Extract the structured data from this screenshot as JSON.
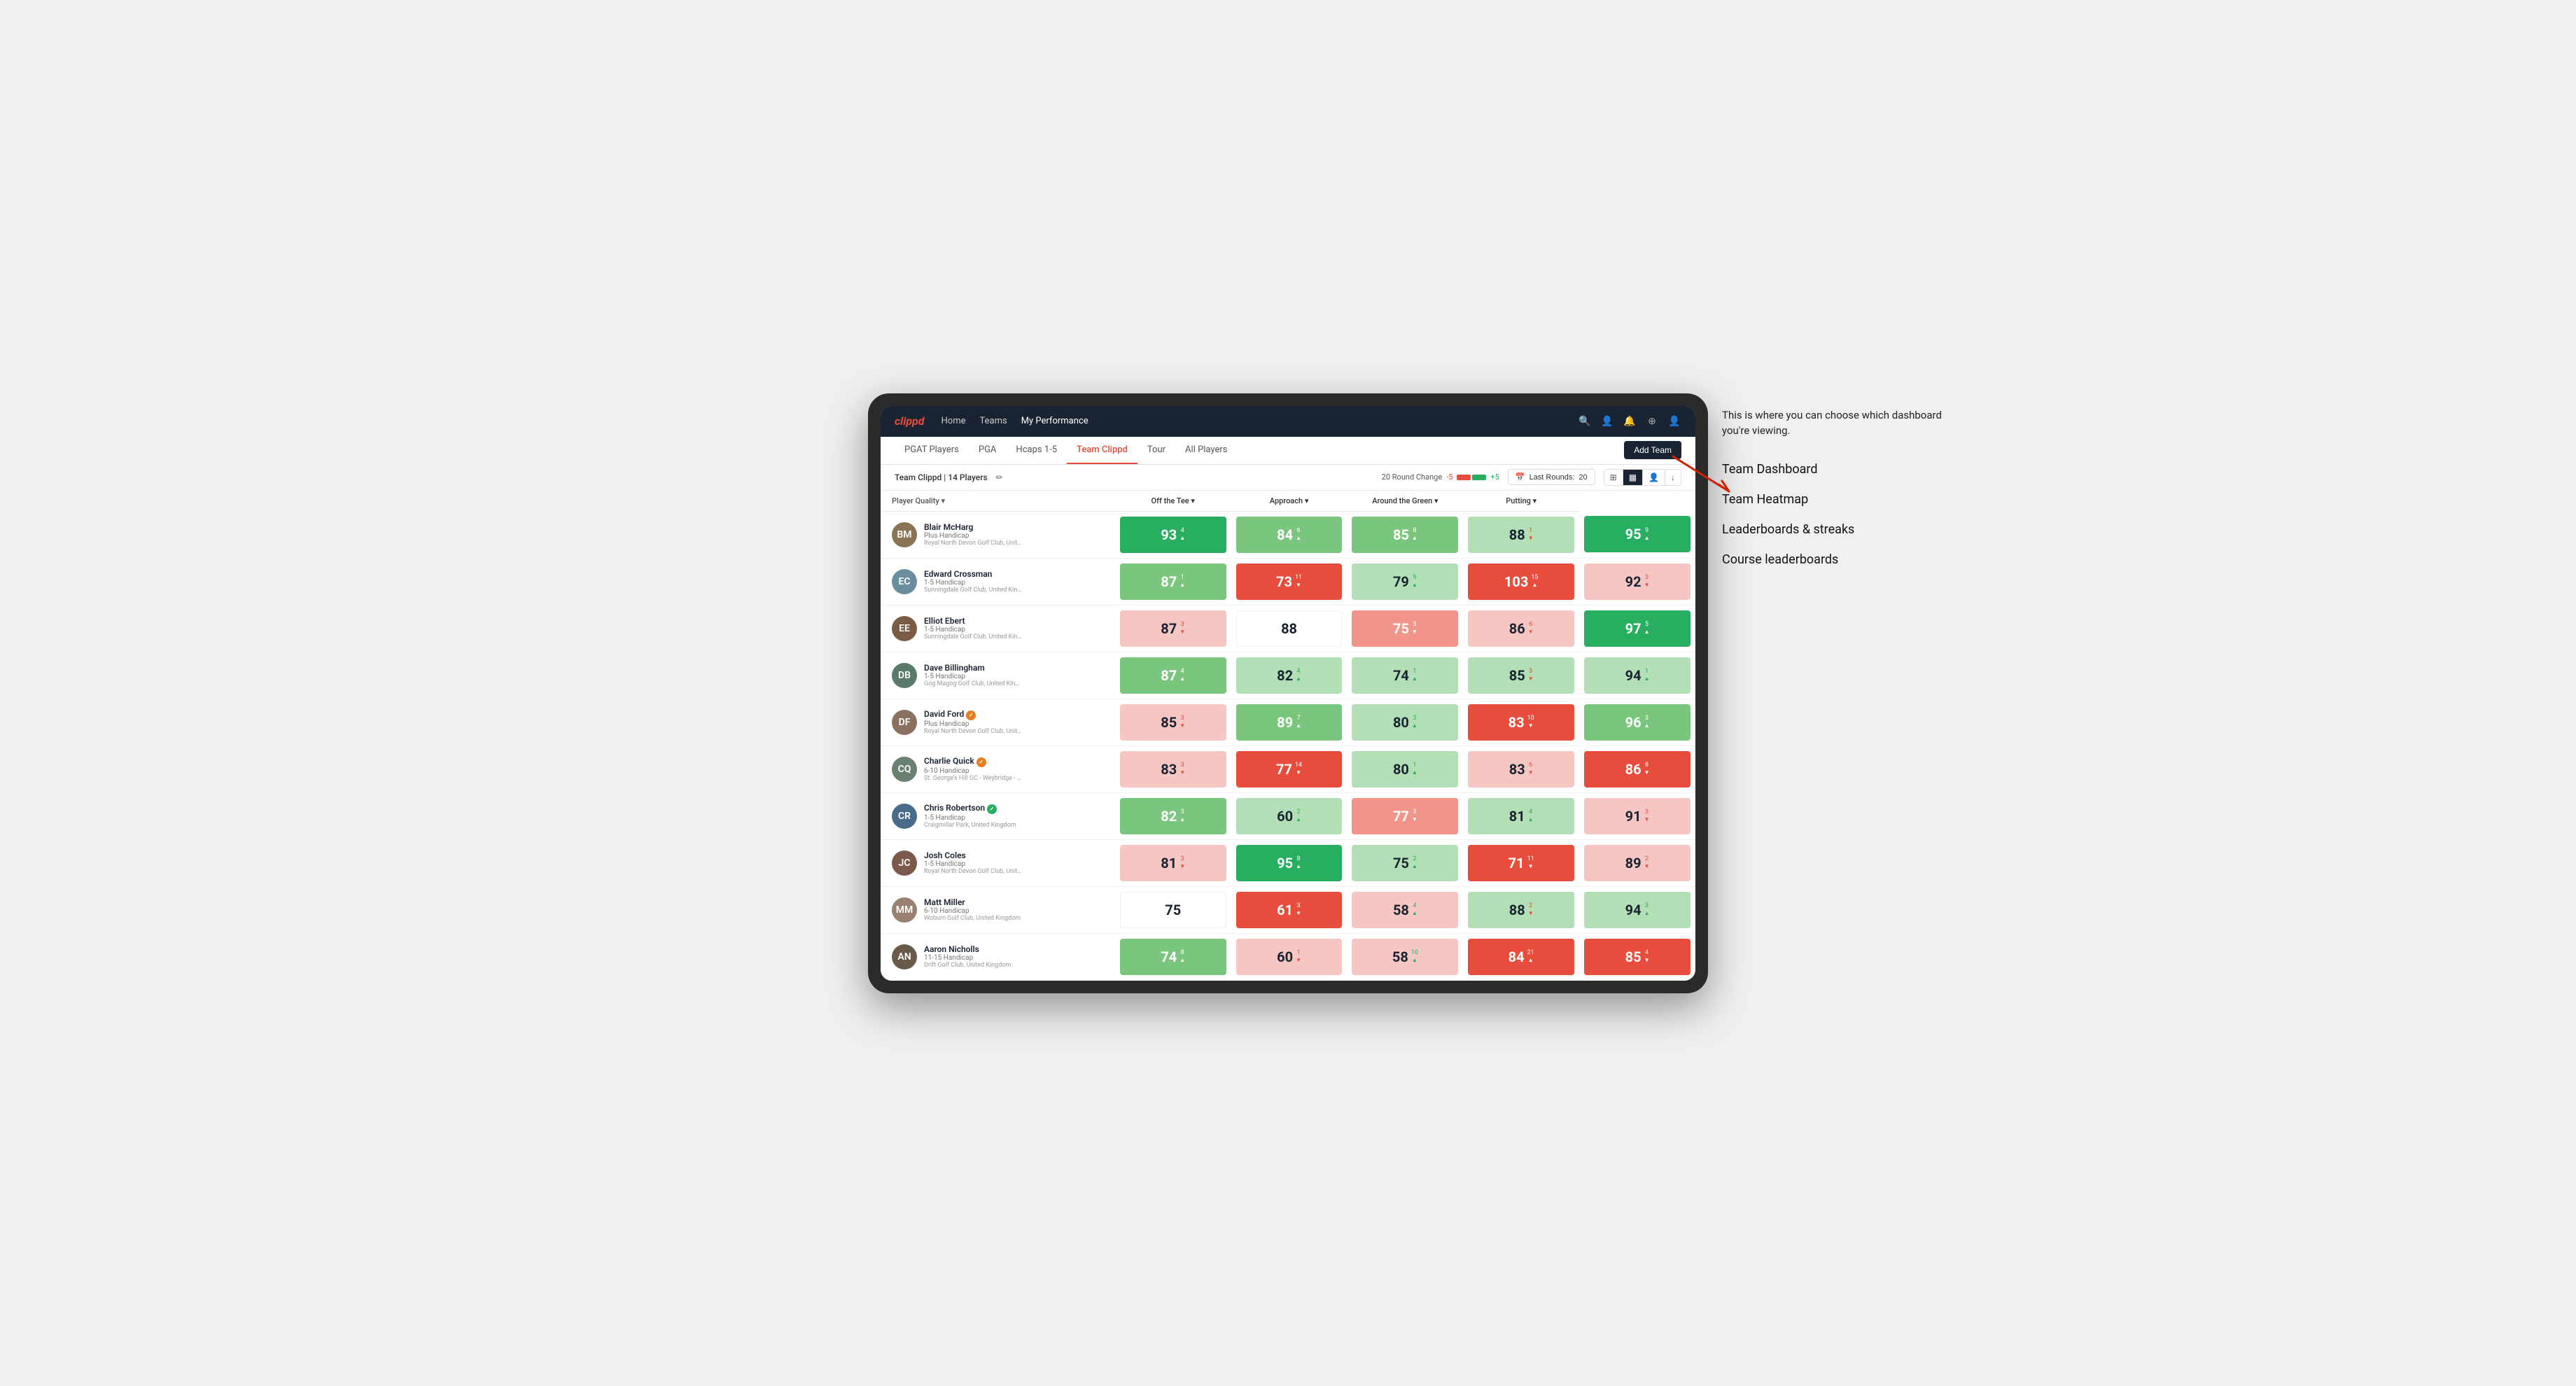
{
  "annotation": {
    "intro": "This is where you can choose which dashboard you're viewing.",
    "menu_items": [
      "Team Dashboard",
      "Team Heatmap",
      "Leaderboards & streaks",
      "Course leaderboards"
    ]
  },
  "nav": {
    "logo": "clippd",
    "links": [
      {
        "label": "Home",
        "active": false
      },
      {
        "label": "Teams",
        "active": false
      },
      {
        "label": "My Performance",
        "active": true
      }
    ],
    "icons": [
      "🔍",
      "👤",
      "🔔",
      "⊕",
      "👤"
    ]
  },
  "subnav": {
    "links": [
      {
        "label": "PGAT Players",
        "active": false
      },
      {
        "label": "PGA",
        "active": false
      },
      {
        "label": "Hcaps 1-5",
        "active": false
      },
      {
        "label": "Team Clippd",
        "active": true
      },
      {
        "label": "Tour",
        "active": false
      },
      {
        "label": "All Players",
        "active": false
      }
    ],
    "add_team_label": "Add Team"
  },
  "toolbar": {
    "team_label": "Team Clippd",
    "player_count": "14 Players",
    "round_change_label": "20 Round Change",
    "round_neg": "-5",
    "round_pos": "+5",
    "last_rounds_label": "Last Rounds:",
    "last_rounds_value": "20",
    "view_options": [
      "grid",
      "heatmap",
      "person",
      "download"
    ]
  },
  "table": {
    "columns": [
      {
        "label": "Player Quality ▾",
        "key": "player_quality"
      },
      {
        "label": "Off the Tee ▾",
        "key": "off_the_tee"
      },
      {
        "label": "Approach ▾",
        "key": "approach"
      },
      {
        "label": "Around the Green ▾",
        "key": "around_green"
      },
      {
        "label": "Putting ▾",
        "key": "putting"
      }
    ],
    "players": [
      {
        "name": "Blair McHarg",
        "handicap": "Plus Handicap",
        "club": "Royal North Devon Golf Club, United Kingdom",
        "avatar_color": "#8B7355",
        "initials": "BM",
        "scores": [
          {
            "val": 93,
            "change": 4,
            "dir": "up",
            "color": "green-dark"
          },
          {
            "val": 84,
            "change": 6,
            "dir": "up",
            "color": "green-light"
          },
          {
            "val": 85,
            "change": 8,
            "dir": "up",
            "color": "green-light"
          },
          {
            "val": 88,
            "change": 1,
            "dir": "down",
            "color": "green-pale"
          },
          {
            "val": 95,
            "change": 9,
            "dir": "up",
            "color": "green-dark"
          }
        ]
      },
      {
        "name": "Edward Crossman",
        "handicap": "1-5 Handicap",
        "club": "Sunningdale Golf Club, United Kingdom",
        "avatar_color": "#6B8E9F",
        "initials": "EC",
        "scores": [
          {
            "val": 87,
            "change": 1,
            "dir": "up",
            "color": "green-light"
          },
          {
            "val": 73,
            "change": 11,
            "dir": "down",
            "color": "red-dark"
          },
          {
            "val": 79,
            "change": 9,
            "dir": "up",
            "color": "green-pale"
          },
          {
            "val": 103,
            "change": 15,
            "dir": "up",
            "color": "red-dark"
          },
          {
            "val": 92,
            "change": 3,
            "dir": "down",
            "color": "red-pale"
          }
        ]
      },
      {
        "name": "Elliot Ebert",
        "handicap": "1-5 Handicap",
        "club": "Sunningdale Golf Club, United Kingdom",
        "avatar_color": "#7a5c44",
        "initials": "EE",
        "scores": [
          {
            "val": 87,
            "change": 3,
            "dir": "down",
            "color": "red-pale"
          },
          {
            "val": 88,
            "change": null,
            "dir": null,
            "color": "neutral"
          },
          {
            "val": 75,
            "change": 3,
            "dir": "down",
            "color": "red-light"
          },
          {
            "val": 86,
            "change": 6,
            "dir": "down",
            "color": "red-pale"
          },
          {
            "val": 97,
            "change": 5,
            "dir": "up",
            "color": "green-dark"
          }
        ]
      },
      {
        "name": "Dave Billingham",
        "handicap": "1-5 Handicap",
        "club": "Gog Magog Golf Club, United Kingdom",
        "avatar_color": "#5a7a6a",
        "initials": "DB",
        "scores": [
          {
            "val": 87,
            "change": 4,
            "dir": "up",
            "color": "green-light"
          },
          {
            "val": 82,
            "change": 4,
            "dir": "up",
            "color": "green-pale"
          },
          {
            "val": 74,
            "change": 1,
            "dir": "up",
            "color": "green-pale"
          },
          {
            "val": 85,
            "change": 3,
            "dir": "down",
            "color": "green-pale"
          },
          {
            "val": 94,
            "change": 1,
            "dir": "up",
            "color": "green-pale"
          }
        ]
      },
      {
        "name": "David Ford",
        "handicap": "Plus Handicap",
        "club": "Royal North Devon Golf Club, United Kingdom",
        "avatar_color": "#8a7060",
        "initials": "DF",
        "badge": "orange",
        "scores": [
          {
            "val": 85,
            "change": 3,
            "dir": "down",
            "color": "red-pale"
          },
          {
            "val": 89,
            "change": 7,
            "dir": "up",
            "color": "green-light"
          },
          {
            "val": 80,
            "change": 3,
            "dir": "up",
            "color": "green-pale"
          },
          {
            "val": 83,
            "change": 10,
            "dir": "down",
            "color": "red-dark"
          },
          {
            "val": 96,
            "change": 3,
            "dir": "up",
            "color": "green-light"
          }
        ]
      },
      {
        "name": "Charlie Quick",
        "handicap": "6-10 Handicap",
        "club": "St. George's Hill GC - Weybridge - Surrey, Uni...",
        "avatar_color": "#6a8070",
        "initials": "CQ",
        "badge": "orange",
        "scores": [
          {
            "val": 83,
            "change": 3,
            "dir": "down",
            "color": "red-pale"
          },
          {
            "val": 77,
            "change": 14,
            "dir": "down",
            "color": "red-dark"
          },
          {
            "val": 80,
            "change": 1,
            "dir": "up",
            "color": "green-pale"
          },
          {
            "val": 83,
            "change": 6,
            "dir": "down",
            "color": "red-pale"
          },
          {
            "val": 86,
            "change": 8,
            "dir": "down",
            "color": "red-dark"
          }
        ]
      },
      {
        "name": "Chris Robertson",
        "handicap": "1-5 Handicap",
        "club": "Craigmillar Park, United Kingdom",
        "avatar_color": "#4a6a8a",
        "initials": "CR",
        "badge": "green",
        "scores": [
          {
            "val": 82,
            "change": 3,
            "dir": "up",
            "color": "green-light"
          },
          {
            "val": 60,
            "change": 2,
            "dir": "up",
            "color": "green-pale"
          },
          {
            "val": 77,
            "change": 3,
            "dir": "down",
            "color": "red-light"
          },
          {
            "val": 81,
            "change": 4,
            "dir": "up",
            "color": "green-pale"
          },
          {
            "val": 91,
            "change": 3,
            "dir": "down",
            "color": "red-pale"
          }
        ]
      },
      {
        "name": "Josh Coles",
        "handicap": "1-5 Handicap",
        "club": "Royal North Devon Golf Club, United Kingdom",
        "avatar_color": "#7a5a4a",
        "initials": "JC",
        "scores": [
          {
            "val": 81,
            "change": 3,
            "dir": "down",
            "color": "red-pale"
          },
          {
            "val": 95,
            "change": 8,
            "dir": "up",
            "color": "green-dark"
          },
          {
            "val": 75,
            "change": 2,
            "dir": "up",
            "color": "green-pale"
          },
          {
            "val": 71,
            "change": 11,
            "dir": "down",
            "color": "red-dark"
          },
          {
            "val": 89,
            "change": 2,
            "dir": "down",
            "color": "red-pale"
          }
        ]
      },
      {
        "name": "Matt Miller",
        "handicap": "6-10 Handicap",
        "club": "Woburn Golf Club, United Kingdom",
        "avatar_color": "#9a8070",
        "initials": "MM",
        "scores": [
          {
            "val": 75,
            "change": null,
            "dir": null,
            "color": "neutral"
          },
          {
            "val": 61,
            "change": 3,
            "dir": "down",
            "color": "red-dark"
          },
          {
            "val": 58,
            "change": 4,
            "dir": "up",
            "color": "red-pale"
          },
          {
            "val": 88,
            "change": 2,
            "dir": "down",
            "color": "green-pale"
          },
          {
            "val": 94,
            "change": 3,
            "dir": "up",
            "color": "green-pale"
          }
        ]
      },
      {
        "name": "Aaron Nicholls",
        "handicap": "11-15 Handicap",
        "club": "Drift Golf Club, United Kingdom",
        "avatar_color": "#6a5a4a",
        "initials": "AN",
        "scores": [
          {
            "val": 74,
            "change": 8,
            "dir": "up",
            "color": "green-light"
          },
          {
            "val": 60,
            "change": 1,
            "dir": "down",
            "color": "red-pale"
          },
          {
            "val": 58,
            "change": 10,
            "dir": "up",
            "color": "red-pale"
          },
          {
            "val": 84,
            "change": 21,
            "dir": "up",
            "color": "red-dark"
          },
          {
            "val": 85,
            "change": 4,
            "dir": "down",
            "color": "red-dark"
          }
        ]
      }
    ]
  }
}
